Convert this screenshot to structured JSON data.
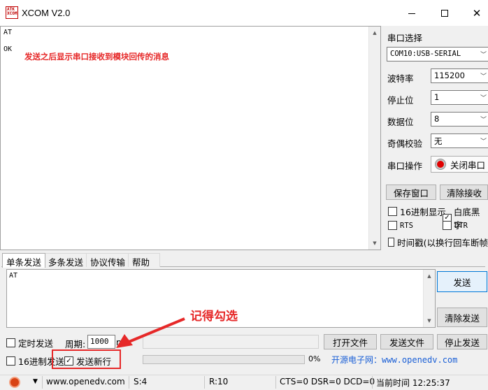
{
  "window": {
    "title": "XCOM V2.0",
    "logo_text": "ATK XCOM"
  },
  "receive": {
    "lines": [
      "AT",
      "OK"
    ],
    "annotation": "发送之后显示串口接收到模块回传的消息"
  },
  "serial": {
    "port_label": "串口选择",
    "port_value": "COM10:USB-SERIAL",
    "baud_label": "波特率",
    "baud_value": "115200",
    "stop_label": "停止位",
    "stop_value": "1",
    "data_label": "数据位",
    "data_value": "8",
    "parity_label": "奇偶校验",
    "parity_value": "无",
    "op_label": "串口操作",
    "op_button": "关闭串口"
  },
  "recv_buttons": {
    "save": "保存窗口",
    "clear": "清除接收"
  },
  "options": {
    "hex_display": {
      "label": "16进制显示",
      "checked": false
    },
    "white_black": {
      "label": "白底黑字",
      "checked": true
    },
    "rts": {
      "label": "RTS",
      "checked": false
    },
    "dtr": {
      "label": "DTR",
      "checked": false
    },
    "timestamp": {
      "label": "时间戳(以换行回车断帧",
      "checked": false
    }
  },
  "tabs": [
    "单条发送",
    "多条发送",
    "协议传输",
    "帮助"
  ],
  "send": {
    "text": "AT",
    "send_button": "发送",
    "clear_button": "清除发送"
  },
  "bottom": {
    "timed_send": {
      "label": "定时发送",
      "checked": false
    },
    "period_label": "周期:",
    "period_value": "1000",
    "period_unit": "ms",
    "open_file": "打开文件",
    "send_file": "发送文件",
    "stop_send": "停止发送",
    "hex_send": {
      "label": "16进制发送",
      "checked": false
    },
    "send_newline": {
      "label": "发送新行",
      "checked": true
    },
    "progress_percent": "0%",
    "annotation": "记得勾选",
    "website": "开源电子网：www.openedv.com"
  },
  "status": {
    "url": "www.openedv.com",
    "sent": "S:4",
    "received": "R:10",
    "lines": "CTS=0 DSR=0 DCD=0",
    "time": "当前时间 12:25:37"
  },
  "colors": {
    "annotation_red": "#e62828",
    "link_blue": "#1a5fd6"
  }
}
